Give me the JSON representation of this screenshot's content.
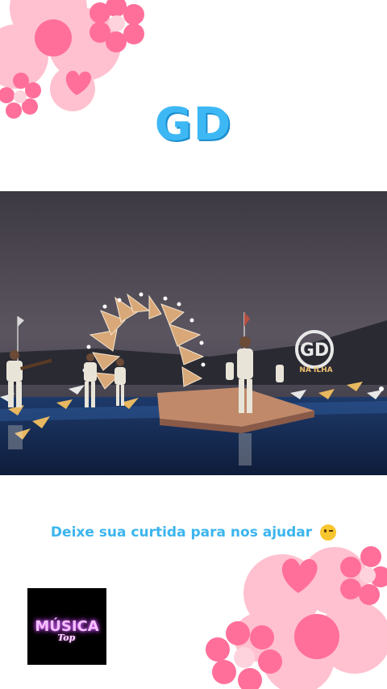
{
  "title": "GD",
  "caption": "Deixe sua curtida para nos ajudar",
  "caption_emoji": "winking-face-icon",
  "logo": {
    "main": "MÚSICA",
    "sub": "Top"
  },
  "video": {
    "stage_sign": "GD",
    "stage_sign_sub": "NA ILHA"
  },
  "colors": {
    "title": "#3db8f5",
    "caption": "#3bb5ee",
    "flower": "#ff6f9a",
    "flower_light": "#ffb6c8"
  }
}
